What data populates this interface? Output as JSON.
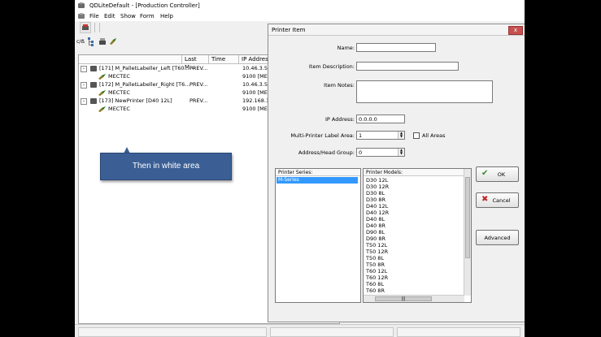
{
  "window": {
    "title": "QDLiteDefault  - [Production Controller]"
  },
  "menu": [
    "File",
    "Edit",
    "Show",
    "Form",
    "Help"
  ],
  "toolbar2": {
    "label": "c/ẞ"
  },
  "tree": {
    "columns": [
      "",
      "Last M...",
      "Time",
      "IP Address"
    ],
    "rows": [
      {
        "level": 0,
        "expander": "-",
        "name": "[171] M_PalletLabeller_Left  [T60...",
        "last": "PREV...",
        "ip": "10.46.3.55"
      },
      {
        "level": 1,
        "expander": "",
        "name": "MECTEC",
        "last": "",
        "ip": "9100 [MEC"
      },
      {
        "level": 0,
        "expander": "-",
        "name": "[172] M_PalletLabeller_Right  [T6...",
        "last": "PREV...",
        "ip": "10.46.3.55"
      },
      {
        "level": 1,
        "expander": "",
        "name": "MECTEC",
        "last": "",
        "ip": "9100 [MEC"
      },
      {
        "level": 0,
        "expander": "-",
        "name": "[173] NewPrinter  [D40 12L]",
        "last": "PREV...",
        "ip": "192.168.1..."
      },
      {
        "level": 1,
        "expander": "",
        "name": "MECTEC",
        "last": "",
        "ip": "9100 [MEC"
      }
    ]
  },
  "callout": {
    "text": "Then in white area"
  },
  "dialog": {
    "title": "Printer Item",
    "close": "x",
    "labels": {
      "name": "Name:",
      "description": "Item Description:",
      "notes": "Item Notes:",
      "ip": "IP Address:",
      "multi_area": "Multi-Printer Label Area:",
      "all_areas": "All Areas",
      "head_group": "Address/Head Group:"
    },
    "values": {
      "name": "",
      "description": "",
      "notes": "",
      "ip": "0.0.0.0",
      "multi_area": "1",
      "head_group": "0"
    },
    "series_header": "Printer Series:",
    "series_selected": "M-Series",
    "models_header": "Printer Models:",
    "models": [
      "D30 12L",
      "D30 12R",
      "D30 8L",
      "D30 8R",
      "D40 12L",
      "D40 12R",
      "D40 8L",
      "D40 8R",
      "D90 8L",
      "D90 8R",
      "T50 12L",
      "T50 12R",
      "T50 8L",
      "T50 8R",
      "T60 12L",
      "T60 12R",
      "T60 8L",
      "T60 8R"
    ],
    "buttons": {
      "ok": "OK",
      "cancel": "Cancel",
      "advanced": "Advanced"
    },
    "icons": {
      "ok": "check-icon",
      "cancel": "cross-icon"
    },
    "colors": {
      "ok_icon": "#2e8b2e",
      "cancel_icon": "#c0282a",
      "selection": "#3399ff",
      "callout": "#3b5f95",
      "close": "#c75050"
    }
  }
}
